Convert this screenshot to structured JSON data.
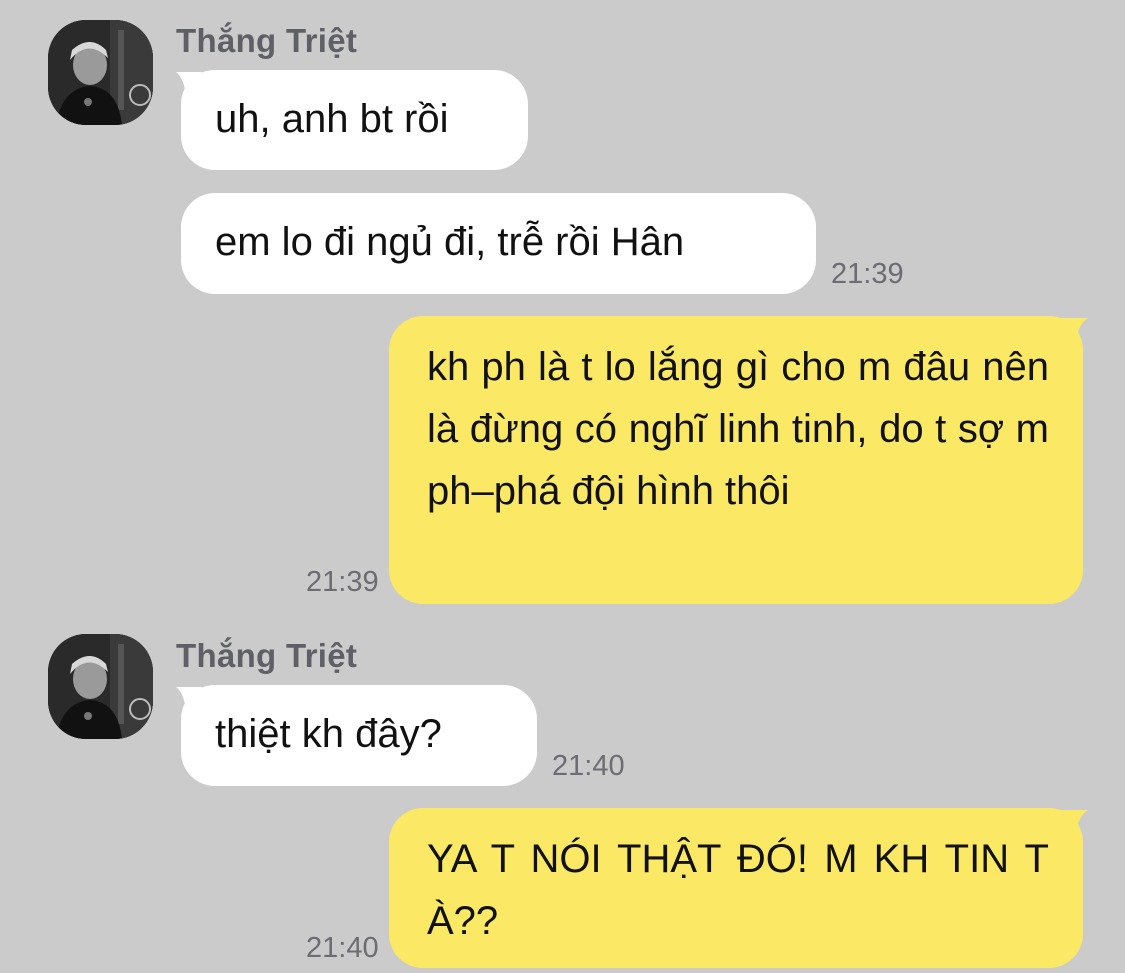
{
  "contact": {
    "name": "Thắng Triệt",
    "avatar_icon": "person-avatar-icon"
  },
  "messages": [
    {
      "side": "in",
      "text": "uh, anh bt rồi",
      "time": ""
    },
    {
      "side": "in",
      "text": "em lo đi ngủ đi, trễ rồi Hân",
      "time": "21:39"
    },
    {
      "side": "out",
      "text": "kh ph là t lo lắng gì cho m đâu nên là đừng có nghĩ linh tinh, do t sợ m ph–phá đội hình thôi",
      "time": "21:39"
    },
    {
      "side": "in",
      "text": "thiệt kh đây?",
      "time": "21:40"
    },
    {
      "side": "out",
      "text": "YA T NÓI THẬT ĐÓ! M KH TIN T À??",
      "time": "21:40"
    }
  ],
  "colors": {
    "background": "#cbcbcb",
    "incoming_bubble": "#ffffff",
    "outgoing_bubble": "#fbe865",
    "name_text": "#5f6065",
    "time_text": "#6c6d72"
  }
}
